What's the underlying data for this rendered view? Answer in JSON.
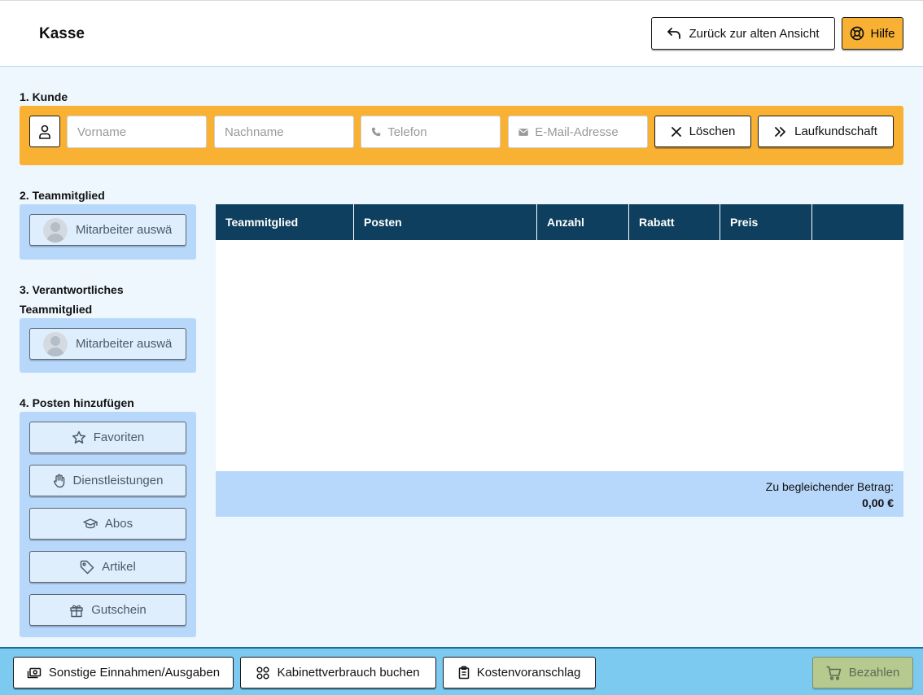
{
  "header": {
    "title": "Kasse",
    "back_label": "Zurück zur alten Ansicht",
    "help_label": "Hilfe"
  },
  "customer": {
    "section_label": "1. Kunde",
    "firstname_placeholder": "Vorname",
    "lastname_placeholder": "Nachname",
    "phone_placeholder": "Telefon",
    "email_placeholder": "E-Mail-Adresse",
    "clear_label": "Löschen",
    "walkin_label": "Laufkundschaft"
  },
  "team_member": {
    "section_label": "2. Teammitglied",
    "select_label": "Mitarbeiter auswä"
  },
  "responsible_member": {
    "section_label_line1": "3. Verantwortliches",
    "section_label_line2": "Teammitglied",
    "select_label": "Mitarbeiter auswä"
  },
  "add_items": {
    "section_label": "4. Posten hinzufügen",
    "buttons": [
      {
        "label": "Favoriten",
        "icon": "star-icon"
      },
      {
        "label": "Dienstleistungen",
        "icon": "hand-icon"
      },
      {
        "label": "Abos",
        "icon": "graduation-cap-icon"
      },
      {
        "label": "Artikel",
        "icon": "tag-icon"
      },
      {
        "label": "Gutschein",
        "icon": "gift-icon"
      }
    ]
  },
  "table": {
    "columns": [
      "Teammitglied",
      "Posten",
      "Anzahl",
      "Rabatt",
      "Preis",
      ""
    ],
    "rows": [],
    "total_label": "Zu begleichender Betrag:",
    "total_value": "0,00 €"
  },
  "footer": {
    "other_income_label": "Sonstige Einnahmen/Ausgaben",
    "cabinet_label": "Kabinettverbrauch buchen",
    "estimate_label": "Kostenvoranschlag",
    "pay_label": "Bezahlen"
  },
  "colors": {
    "accent_orange": "#f8b133",
    "header_navy": "#0f3f5e",
    "panel_blue": "#b7d8fb",
    "footer_blue": "#7dcaf0",
    "pay_green": "#b6c98f"
  }
}
